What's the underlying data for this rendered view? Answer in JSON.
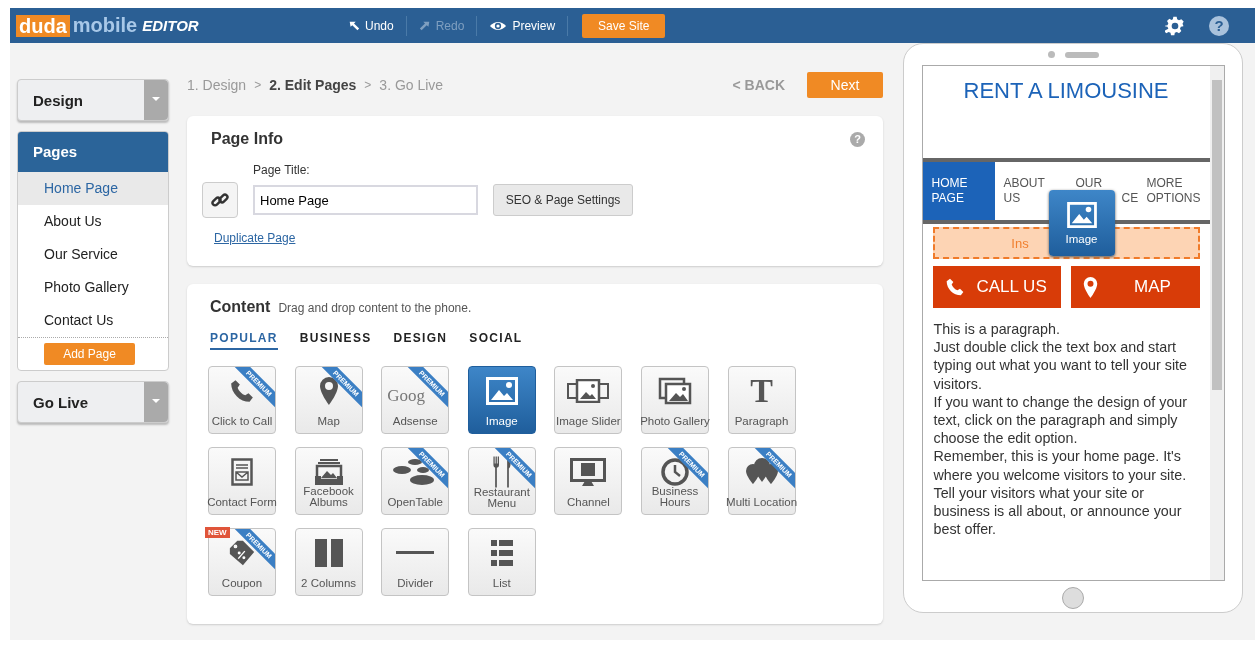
{
  "topbar": {
    "logo": {
      "brand": "duda",
      "product": "mobile",
      "tag": "EDITOR"
    },
    "actions": [
      {
        "label": "Undo",
        "kind": "undo",
        "disabled": false
      },
      {
        "label": "Redo",
        "kind": "redo",
        "disabled": true
      },
      {
        "label": "Preview",
        "kind": "preview",
        "disabled": false
      }
    ],
    "save": "Save Site",
    "help": "?"
  },
  "sidebar": {
    "design": "Design",
    "pages_title": "Pages",
    "pages": [
      {
        "label": "Home Page",
        "selected": true
      },
      {
        "label": "About Us",
        "selected": false
      },
      {
        "label": "Our Service",
        "selected": false
      },
      {
        "label": "Photo Gallery",
        "selected": false
      },
      {
        "label": "Contact Us",
        "selected": false
      }
    ],
    "add_page": "Add Page",
    "go_live": "Go Live"
  },
  "steps": [
    {
      "label": "1. Design",
      "selected": false
    },
    {
      "label": "2. Edit Pages",
      "selected": true
    },
    {
      "label": "3. Go Live",
      "selected": false
    }
  ],
  "step_separators": [
    ">",
    ">"
  ],
  "back": "< BACK",
  "next": "Next",
  "page_info": {
    "title": "Page Info",
    "help": "?",
    "field_label": "Page Title:",
    "value": "Home Page",
    "seo": "SEO & Page Settings",
    "duplicate": "Duplicate Page"
  },
  "content": {
    "title": "Content",
    "hint": "Drag and drop content to the phone.",
    "tabs": [
      {
        "label": "POPULAR",
        "selected": true
      },
      {
        "label": "BUSINESS",
        "selected": false
      },
      {
        "label": "DESIGN",
        "selected": false
      },
      {
        "label": "SOCIAL",
        "selected": false
      }
    ],
    "tiles": [
      {
        "label": "Click to Call",
        "kind": "phone",
        "ribbon": "PREMIUM",
        "selected": false
      },
      {
        "label": "Map",
        "kind": "pin",
        "ribbon": "PREMIUM",
        "selected": false
      },
      {
        "label": "Adsense",
        "kind": "logo",
        "logo_text": "Goog",
        "ribbon": "PREMIUM",
        "selected": false
      },
      {
        "label": "Image",
        "kind": "image",
        "selected": true
      },
      {
        "label": "Image Slider",
        "kind": "slider",
        "selected": false
      },
      {
        "label": "Photo Gallery",
        "kind": "gallery",
        "selected": false
      },
      {
        "label": "Paragraph",
        "kind": "letter",
        "logo_text": "T",
        "selected": false
      },
      {
        "label": "Contact Form",
        "kind": "form",
        "selected": false
      },
      {
        "label": "Facebook Albums",
        "kind": "albums",
        "selected": false
      },
      {
        "label": "OpenTable",
        "kind": "stones",
        "ribbon": "PREMIUM",
        "selected": false
      },
      {
        "label": "Restaurant Menu",
        "kind": "cutlery",
        "ribbon": "PREMIUM",
        "selected": false
      },
      {
        "label": "Channel",
        "kind": "monitor",
        "selected": false
      },
      {
        "label": "Business Hours",
        "kind": "clock",
        "ribbon": "PREMIUM",
        "selected": false
      },
      {
        "label": "Multi Location",
        "kind": "pins",
        "ribbon": "PREMIUM",
        "selected": false
      },
      {
        "label": "Coupon",
        "kind": "tag",
        "ribbon": "PREMIUM",
        "badge": "NEW",
        "selected": false
      },
      {
        "label": "2 Columns",
        "kind": "columns",
        "selected": false
      },
      {
        "label": "Divider",
        "kind": "divider",
        "selected": false
      },
      {
        "label": "List",
        "kind": "list",
        "selected": false
      }
    ]
  },
  "phone": {
    "title": "RENT A LIMOUSINE",
    "nav": [
      {
        "lines": [
          "HOME",
          "PAGE"
        ],
        "selected": true
      },
      {
        "lines": [
          "ABOUT",
          "US"
        ],
        "selected": false
      },
      {
        "lines": [
          "OUR",
          "CE"
        ],
        "selected": false
      },
      {
        "lines": [
          "MORE",
          "OPTIONS"
        ],
        "selected": false
      }
    ],
    "drop_zone": "Ins",
    "call": "CALL US",
    "map": "MAP",
    "paragraphs": [
      "This is a paragraph.",
      "Just double click the text box and start typing out what you want to tell your site visitors.",
      "If you want to change the design of your text, click on the paragraph and simply choose the edit option.",
      "Remember, this is your home page. It's where you welcome visitors to your site. Tell your visitors what your site or business is all about, or announce your best offer."
    ],
    "dragged": "Image"
  }
}
